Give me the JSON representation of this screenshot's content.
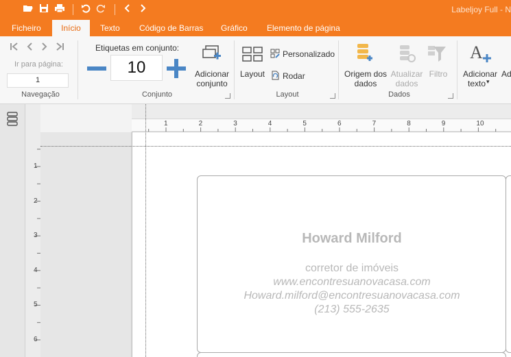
{
  "window": {
    "title": "Labeljoy Full - N"
  },
  "quick_access": [
    "open-icon",
    "save-icon",
    "print-icon",
    "undo-icon",
    "redo-icon",
    "back-icon",
    "forward-icon"
  ],
  "tabs": [
    {
      "label": "Ficheiro"
    },
    {
      "label": "Início"
    },
    {
      "label": "Texto"
    },
    {
      "label": "Código de Barras"
    },
    {
      "label": "Gráfico"
    },
    {
      "label": "Elemento de página"
    }
  ],
  "ribbon": {
    "navigation": {
      "goto_label": "Ir para página:",
      "page_value": "1",
      "group_label": "Navegação"
    },
    "set": {
      "label": "Etiquetas em conjunto:",
      "count": "10",
      "add_line1": "Adicionar",
      "add_line2": "conjunto",
      "group_label": "Conjunto"
    },
    "layout": {
      "layout_button": "Layout",
      "custom_button": "Personalizado",
      "rotate_button": "Rodar",
      "group_label": "Layout"
    },
    "data": {
      "source_line1": "Origem dos",
      "source_line2": "dados",
      "update_line1": "Atualizar",
      "update_line2": "dados",
      "filter_button": "Filtro",
      "group_label": "Dados"
    },
    "text": {
      "add_line1": "Adicionar",
      "add_line2": "texto",
      "add_dropdown": "▾",
      "next_partial": "Ad"
    }
  },
  "rulers": {
    "horizontal": [
      "1",
      "2",
      "3",
      "4",
      "5",
      "6",
      "7",
      "8",
      "9",
      "10"
    ],
    "vertical": [
      "1",
      "2",
      "3",
      "4",
      "5",
      "6"
    ]
  },
  "card": {
    "name": "Howard Milford",
    "title": "corretor de imóveis",
    "website": "www.encontresuanovacasa.com",
    "email": "Howard.milford@encontresuanovacasa.com",
    "phone": "(213) 555-2635"
  },
  "colors": {
    "accent": "#f47b20",
    "blue": "#4a86c5",
    "card_text": "#b8b8b8"
  }
}
